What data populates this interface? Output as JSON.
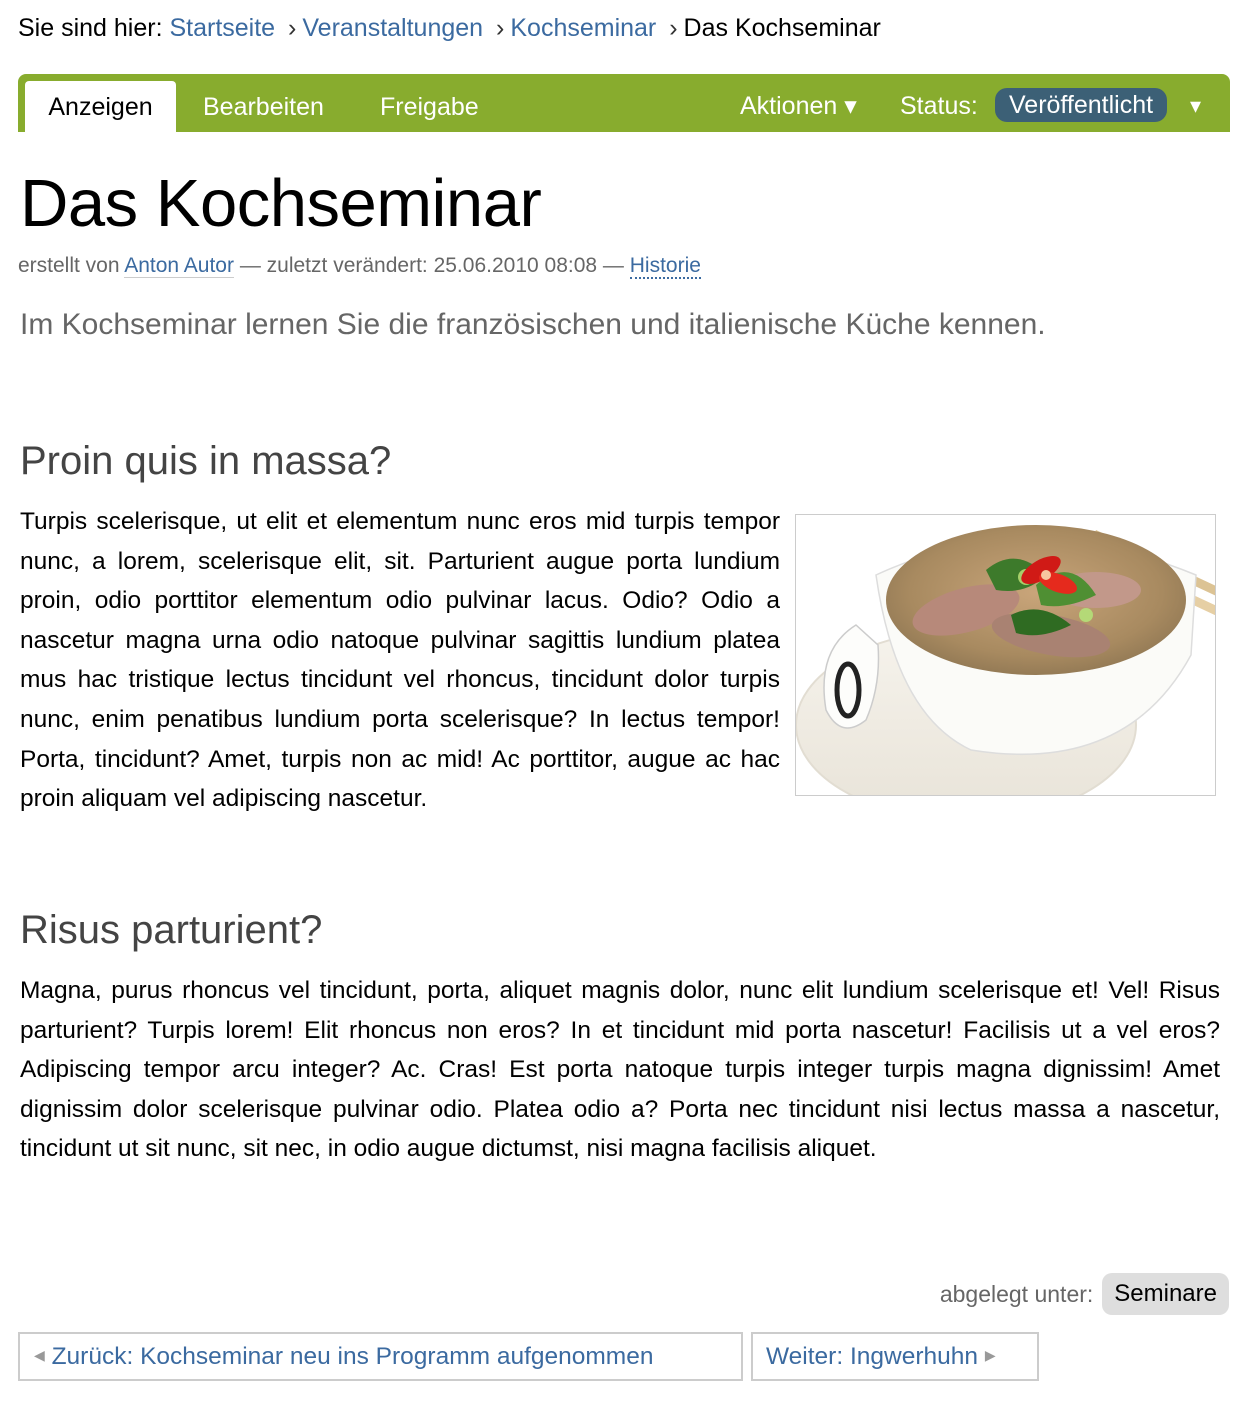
{
  "breadcrumb": {
    "prefix": "Sie sind hier:",
    "items": [
      "Startseite",
      "Veranstaltungen",
      "Kochseminar"
    ],
    "separator": "›",
    "current": "Das Kochseminar"
  },
  "editbar": {
    "color": "#88ac2e",
    "tabs": [
      "Anzeigen",
      "Bearbeiten",
      "Freigabe"
    ],
    "active_tab": "Anzeigen",
    "actions_label": "Aktionen ▾",
    "status_label": "Status:",
    "status_value": "Veröffentlicht",
    "status_caret": "▾"
  },
  "page": {
    "title": "Das Kochseminar",
    "byline": {
      "created_prefix": "erstellt von",
      "author": "Anton Autor",
      "modified_prefix": "— zuletzt verändert: 25.06.2010 08:08 —",
      "history": "Historie"
    },
    "description": "Im Kochseminar lernen Sie die französischen und italienische Küche kennen."
  },
  "sections": [
    {
      "heading": "Proin quis in massa?",
      "text": "Turpis scelerisque, ut elit et elementum nunc eros mid turpis tempor nunc, a lorem, scelerisque elit, sit. Parturient augue porta lundium proin, odio porttitor elementum odio pulvinar lacus. Odio? Odio a nascetur magna urna odio natoque pulvinar sagittis lundium platea mus hac tristique lectus tincidunt vel rhoncus, tincidunt dolor turpis nunc, enim penatibus lundium porta scelerisque? In lectus tempor! Porta, tincidunt? Amet, turpis non ac mid! Ac porttitor, augue ac hac proin aliquam vel adipiscing nascetur."
    },
    {
      "heading": "Risus parturient?",
      "text": "Magna, purus rhoncus vel tincidunt, porta, aliquet magnis dolor, nunc elit lundium scelerisque et! Vel! Risus parturient? Turpis lorem! Elit rhoncus non eros? In et tincidunt mid porta nascetur! Facilisis ut a vel eros? Adipiscing tempor arcu integer? Ac. Cras! Est porta natoque turpis integer turpis magna dignissim! Amet dignissim dolor scelerisque pulvinar odio. Platea odio a? Porta nec tincidunt nisi lectus massa a nascetur, tincidunt ut sit nunc, sit nec, in odio augue dictumst, nisi magna facilisis aliquet."
    }
  ],
  "image": {
    "subject": "soup-bowl-photo"
  },
  "footer": {
    "filed_label": "abgelegt unter:",
    "filed_tag": "Seminare",
    "prev": "Zurück: Kochseminar neu ins Programm aufgenommen",
    "next": "Weiter: Ingwerhuhn"
  }
}
